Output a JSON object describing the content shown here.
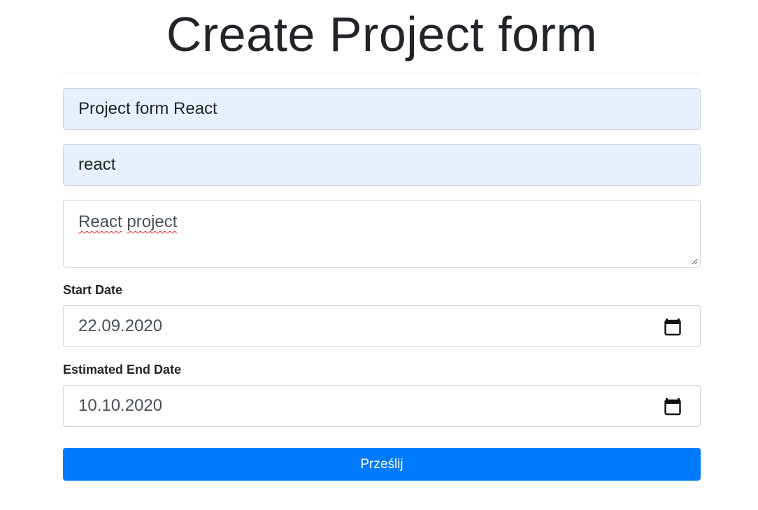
{
  "page": {
    "title": "Create Project form"
  },
  "form": {
    "project_name": {
      "value": "Project form React"
    },
    "project_identifier": {
      "value": "react"
    },
    "description": {
      "word1": "React",
      "word2": "project"
    },
    "start_date": {
      "label": "Start Date",
      "value": "22.09.2020"
    },
    "end_date": {
      "label": "Estimated End Date",
      "value": "10.10.2020"
    },
    "submit_label": "Prześlij"
  },
  "colors": {
    "primary": "#007bff",
    "autofill_bg": "#e8f0fe",
    "border": "#ced4da",
    "text": "#212529"
  },
  "icons": {
    "date_picker": "calendar-icon",
    "textarea_resize": "resize-handle-icon"
  }
}
